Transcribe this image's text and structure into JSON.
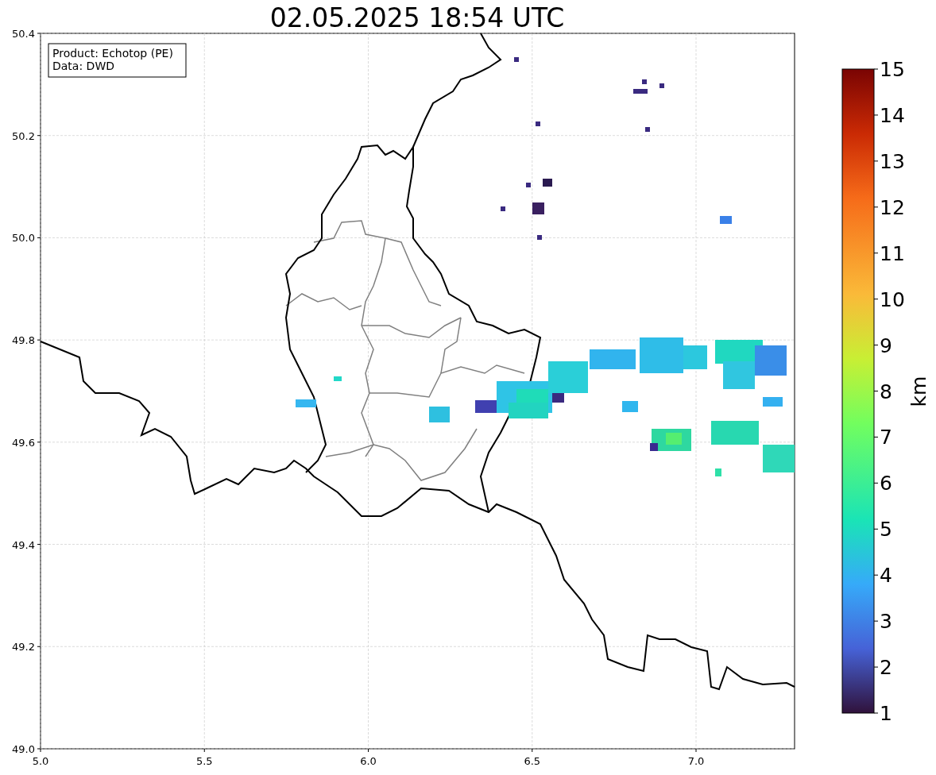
{
  "title": "02.05.2025 18:54 UTC",
  "info_box": [
    "Product: Echotop (PE)",
    "Data: DWD"
  ],
  "map": {
    "xticks": [
      "5.0",
      "5.5",
      "6.0",
      "6.5",
      "7.0"
    ],
    "yticks": [
      "50.4",
      "50.2",
      "50.0",
      "49.8",
      "49.6",
      "49.4",
      "49.2",
      "49.0"
    ]
  },
  "colorbar": {
    "label": "km",
    "ticks": [
      "15",
      "14",
      "13",
      "12",
      "11",
      "10",
      "9",
      "8",
      "7",
      "6",
      "5",
      "4",
      "3",
      "2",
      "1"
    ]
  }
}
